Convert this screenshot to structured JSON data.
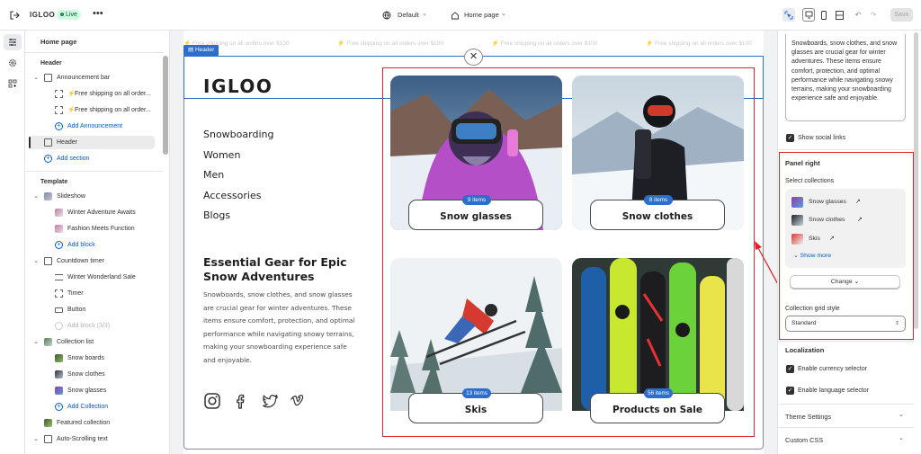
{
  "topbar": {
    "store_name": "IGLOO",
    "live_badge": "Live",
    "more": "•••",
    "theme_selector": "Default",
    "page_selector": "Home page",
    "save_label": "Save"
  },
  "rail": {
    "items": [
      "sections-icon",
      "gear-icon",
      "apps-icon"
    ]
  },
  "sidebar": {
    "page_title": "Home page",
    "header_group": "Header",
    "announcement_bar": "Announcement bar",
    "announcements": [
      "Free shipping on all order...",
      "Free shipping on all order..."
    ],
    "add_announcement": "Add Announcement",
    "header_item": "Header",
    "add_section_1": "Add section",
    "template_group": "Template",
    "slideshow": "Slideshow",
    "slides": [
      "Winter Adventure Awaits",
      "Fashion Meets Function"
    ],
    "add_block_1": "Add block",
    "countdown": "Countdown timer",
    "countdown_items": [
      "Winter Wonderland Sale",
      "Timer",
      "Button"
    ],
    "add_block_2": "Add block (3/3)",
    "collection_list": "Collection list",
    "collections": [
      "Snow boards",
      "Snow clothes",
      "Snow glasses"
    ],
    "add_collection": "Add Collection",
    "featured_collection": "Featured collection",
    "auto_scrolling": "Auto-Scrolling text"
  },
  "preview": {
    "announcement_text": "Free shipping on all orders over $100",
    "header_tag": "Header",
    "logo": "IGLOO",
    "nav": [
      "Snowboarding",
      "Women",
      "Men",
      "Accessories",
      "Blogs"
    ],
    "essential_title": "Essential Gear for Epic Snow Adventures",
    "essential_body": "Snowboards, snow clothes, and snow glasses are crucial gear for winter adventures. These items ensure comfort, protection, and optimal performance while navigating snowy terrains, making your snowboarding experience safe and enjoyable.",
    "socials": [
      "instagram-icon",
      "facebook-icon",
      "twitter-icon",
      "vimeo-icon"
    ],
    "cards": [
      {
        "name": "Snow glasses",
        "badge": "9 items"
      },
      {
        "name": "Snow clothes",
        "badge": "8 items"
      },
      {
        "name": "Skis",
        "badge": "13 items"
      },
      {
        "name": "Products on Sale",
        "badge": "56 items"
      }
    ]
  },
  "settings": {
    "description_text": "Snowboards, snow clothes, and snow glasses are crucial gear for winter adventures. These items ensure comfort, protection, and optimal performance while navigating snowy terrains, making your snowboarding experience safe and enjoyable.",
    "show_social_links": "Show social links",
    "panel_right": "Panel right",
    "select_collections": "Select collections",
    "selected_collections": [
      "Snow glasses",
      "Snow clothes",
      "Skis"
    ],
    "show_more": "Show more",
    "change": "Change",
    "grid_style_label": "Collection grid style",
    "grid_style_value": "Standard",
    "localization": "Localization",
    "currency_selector": "Enable currency selector",
    "language_selector": "Enable language selector",
    "theme_settings": "Theme Settings",
    "custom_css": "Custom CSS"
  },
  "colors": {
    "accent": "#2c6ecb",
    "highlight": "#e0242e",
    "link": "#005bd3"
  }
}
